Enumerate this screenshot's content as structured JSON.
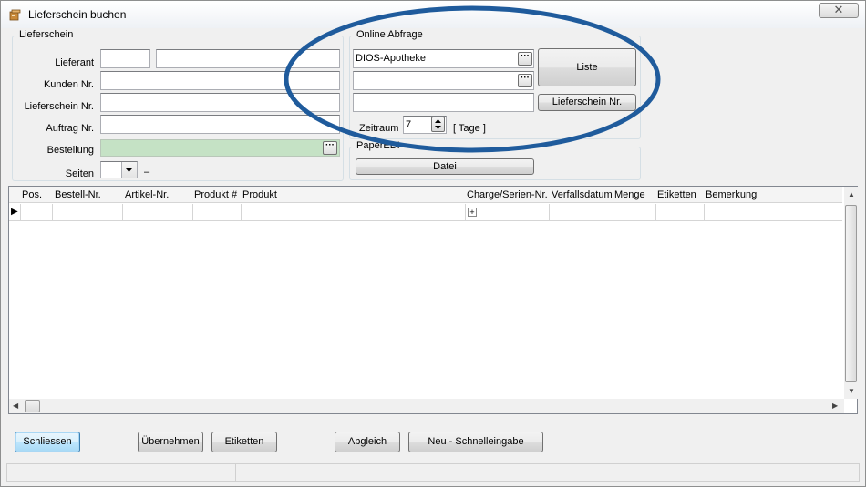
{
  "window": {
    "title": "Lieferschein buchen",
    "close_glyph": "✕"
  },
  "lieferschein_group": {
    "title": "Lieferschein",
    "labels": {
      "lieferant": "Lieferant",
      "kunden_nr": "Kunden Nr.",
      "lieferschein_nr": "Lieferschein Nr.",
      "auftrag_nr": "Auftrag Nr.",
      "bestellung": "Bestellung",
      "seiten": "Seiten"
    },
    "values": {
      "lieferant_code": "",
      "lieferant_name": "",
      "kunden_nr": "",
      "lieferschein_nr": "",
      "auftrag_nr": "",
      "bestellung": "",
      "seiten": ""
    },
    "seiten_suffix": "–"
  },
  "online_group": {
    "title": "Online Abfrage",
    "apotheke": "DIOS-Apotheke",
    "field2": "",
    "field3": "",
    "liste_button": "Liste",
    "lieferschein_button": "Lieferschein Nr.",
    "zeitraum_label": "Zeitraum",
    "zeitraum_value": "7",
    "tage_label": "[ Tage ]"
  },
  "paperedi_group": {
    "title": "PaperEDI",
    "datei_button": "Datei"
  },
  "grid": {
    "columns": [
      "Pos.",
      "Bestell-Nr.",
      "Artikel-Nr.",
      "Produkt #",
      "Produkt",
      "Charge/Serien-Nr.",
      "Verfallsdatum",
      "Menge",
      "Etiketten",
      "Bemerkung"
    ],
    "row_indicator": "▶",
    "expand_glyph": "+"
  },
  "buttons": {
    "schliessen": "Schliessen",
    "uebernehmen": "Übernehmen",
    "etiketten": "Etiketten",
    "abgleich": "Abgleich",
    "neu": "Neu - Schnelleingabe"
  },
  "icons": {
    "app": "package-icon",
    "dots": "ellipsis-icon",
    "spin": "spin-updown-icon"
  },
  "colors": {
    "highlight_ellipse": "#1f5b9c",
    "bestellung_bg": "#c5e2c5"
  }
}
